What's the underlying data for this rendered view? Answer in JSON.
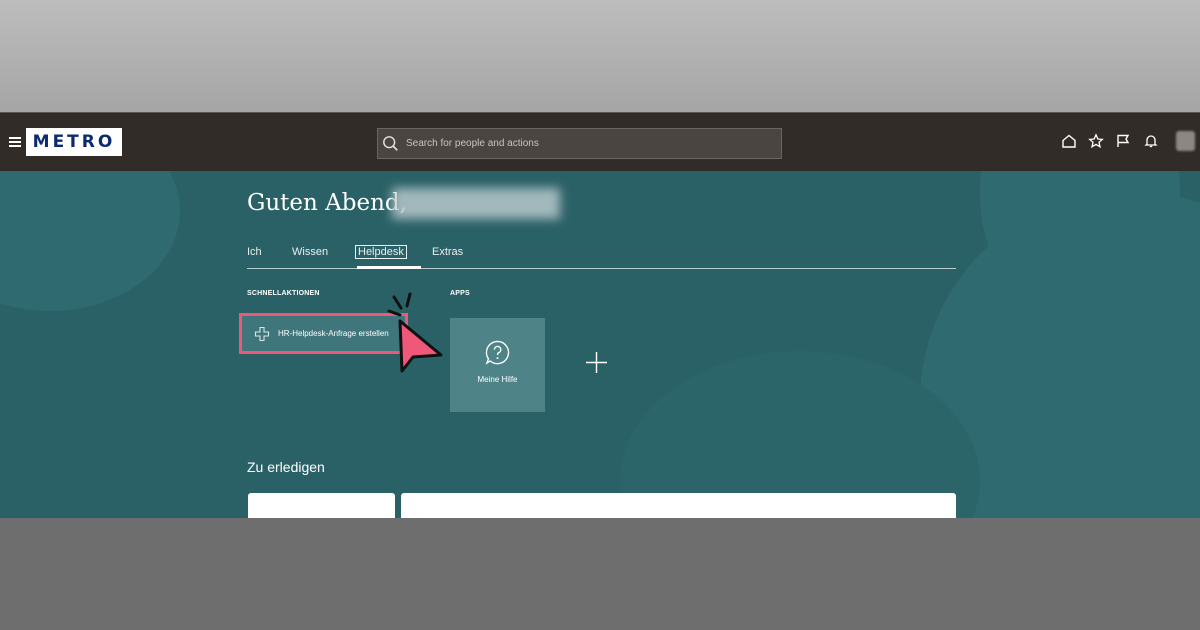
{
  "header": {
    "logo_text_1": "METR",
    "logo_text_2": "O",
    "search_placeholder": "Search for people and actions",
    "icons": [
      "menu-icon",
      "search-icon",
      "home-icon",
      "star-icon",
      "flag-icon",
      "bell-icon",
      "avatar"
    ]
  },
  "main": {
    "greeting": "Guten Abend,",
    "tabs": [
      {
        "label": "Ich"
      },
      {
        "label": "Wissen"
      },
      {
        "label": "Helpdesk"
      },
      {
        "label": "Extras"
      }
    ],
    "active_tab": "Helpdesk",
    "quick_actions_label": "SCHNELLAKTIONEN",
    "quick_actions": [
      {
        "label": "HR-Helpdesk-Anfrage erstellen",
        "icon": "plus-outline-icon"
      }
    ],
    "apps_label": "APPS",
    "apps": [
      {
        "label": "Meine Hilfe",
        "icon": "help-bubble-icon"
      }
    ],
    "todo_title": "Zu erledigen"
  },
  "colors": {
    "nav_bg": "#322c28",
    "hero_bg": "#2a6167",
    "highlight": "#f0587a",
    "logo_blue": "#0b2a6f",
    "logo_yellow": "#ffd400"
  }
}
